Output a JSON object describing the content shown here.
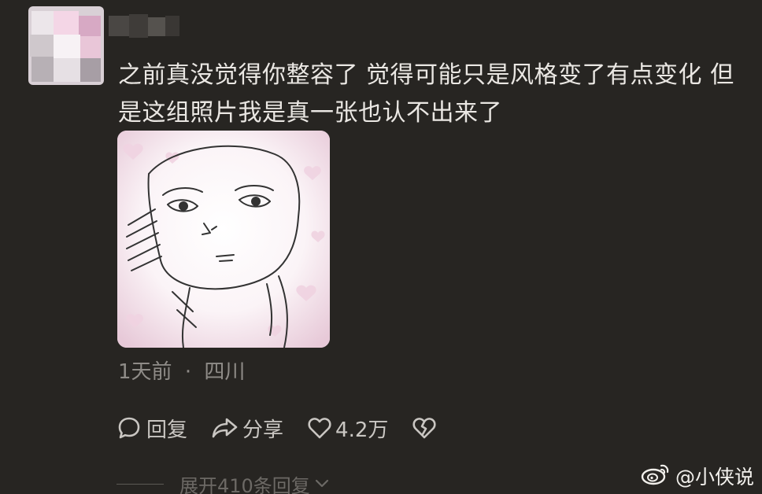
{
  "comment": {
    "line1": "之前真没觉得你整容了 觉得可能只是风格变了有点变化 但",
    "line2": "是这组照片我是真一张也认不出来了",
    "time": "1天前",
    "separator": "·",
    "location": "四川"
  },
  "actions": {
    "reply_label": "回复",
    "share_label": "分享",
    "like_count": "4.2万"
  },
  "replies": {
    "expand_label": "展开410条回复"
  },
  "watermark": {
    "handle": "@小侠说"
  },
  "icons": {
    "reply": "speech-bubble-icon",
    "share": "share-arrow-icon",
    "like": "heart-outline-icon",
    "dislike": "broken-heart-icon",
    "expand": "chevron-down-icon",
    "watermark": "weibo-logo-icon"
  },
  "colors": {
    "background": "#272522",
    "text": "#eae7e3",
    "meta": "#8f8c88",
    "action": "#c9c6c2"
  }
}
